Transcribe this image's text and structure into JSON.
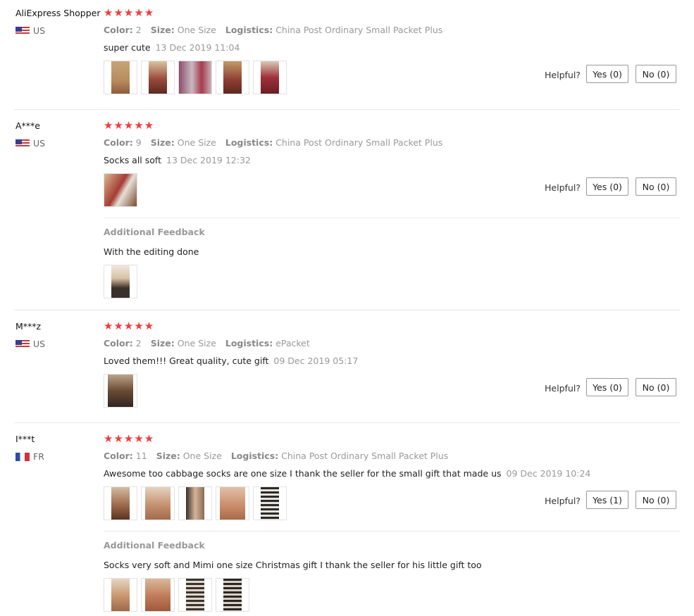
{
  "labels": {
    "color": "Color:",
    "size": "Size:",
    "logistics": "Logistics:",
    "helpful": "Helpful?",
    "additional_feedback": "Additional Feedback"
  },
  "stars_text": "★★★★★",
  "reviews": [
    {
      "user": "AliExpress Shopper",
      "country": "US",
      "rating": 5,
      "color": "2",
      "size": "One Size",
      "logistics": "China Post Ordinary Small Packet Plus",
      "text": "super cute",
      "date": "13 Dec 2019 11:04",
      "photo_count": 5,
      "yes_label": "Yes (0)",
      "no_label": "No (0)"
    },
    {
      "user": "A***e",
      "country": "US",
      "rating": 5,
      "color": "9",
      "size": "One Size",
      "logistics": "China Post Ordinary Small Packet Plus",
      "text": "Socks all soft",
      "date": "13 Dec 2019 12:32",
      "photo_count": 1,
      "yes_label": "Yes (0)",
      "no_label": "No (0)",
      "additional": {
        "text": "With the editing done",
        "photo_count": 1
      }
    },
    {
      "user": "M***z",
      "country": "US",
      "rating": 5,
      "color": "2",
      "size": "One Size",
      "logistics": "ePacket",
      "text": "Loved them!!! Great quality, cute gift",
      "date": "09 Dec 2019 05:17",
      "photo_count": 1,
      "yes_label": "Yes (0)",
      "no_label": "No (0)"
    },
    {
      "user": "I***t",
      "country": "FR",
      "rating": 5,
      "color": "11",
      "size": "One Size",
      "logistics": "China Post Ordinary Small Packet Plus",
      "text": "Awesome too cabbage socks are one size I thank the seller for the small gift that made us",
      "date": "09 Dec 2019 10:24",
      "photo_count": 5,
      "yes_label": "Yes (1)",
      "no_label": "No (0)",
      "additional": {
        "text": "Socks very soft and Mimi one size Christmas gift I thank the seller for his little gift too",
        "photo_count": 4
      }
    }
  ],
  "colors": {
    "star": "#f03c3c",
    "meta_gray": "#999999",
    "separator": "#e8e8e8"
  }
}
